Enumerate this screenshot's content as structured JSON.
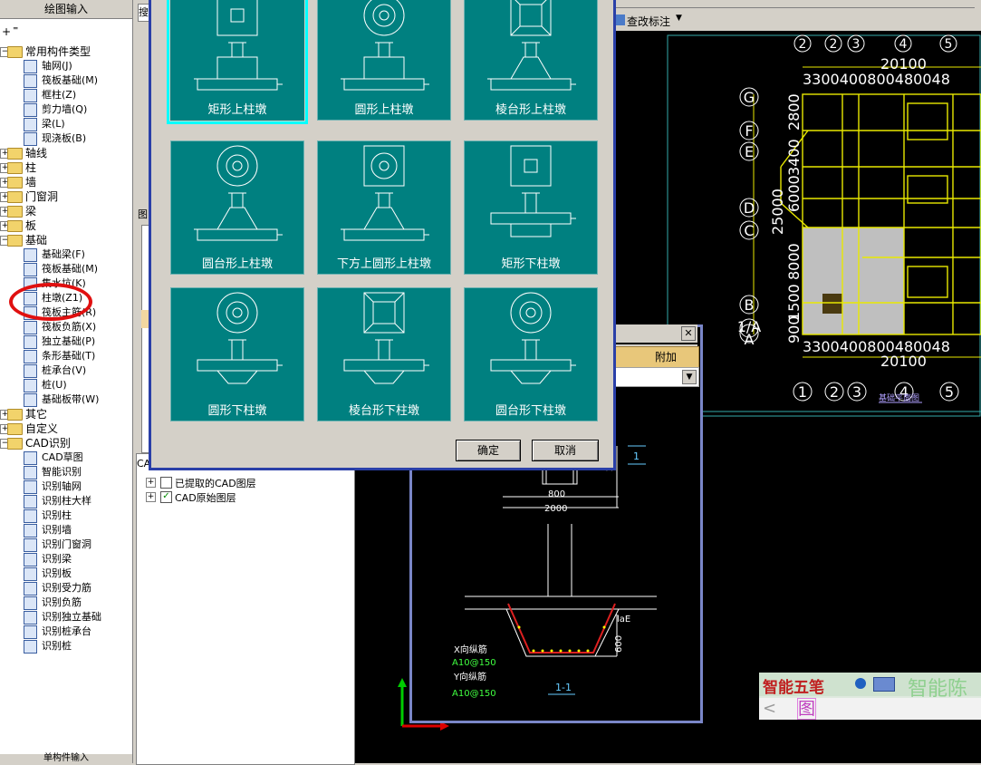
{
  "left_panel": {
    "title": "绘图输入",
    "bottom_label": "单构件输入",
    "tree": [
      {
        "label": "常用构件类型",
        "level": 0,
        "kind": "folder",
        "expanded": true
      },
      {
        "label": "轴网(J)",
        "level": 1,
        "kind": "item",
        "icon": "grid-icon"
      },
      {
        "label": "筏板基础(M)",
        "level": 1,
        "kind": "item",
        "icon": "raft-icon"
      },
      {
        "label": "框柱(Z)",
        "level": 1,
        "kind": "item",
        "icon": "column-icon"
      },
      {
        "label": "剪力墙(Q)",
        "level": 1,
        "kind": "item",
        "icon": "wall-icon"
      },
      {
        "label": "梁(L)",
        "level": 1,
        "kind": "item",
        "icon": "beam-icon"
      },
      {
        "label": "现浇板(B)",
        "level": 1,
        "kind": "item",
        "icon": "slab-icon"
      },
      {
        "label": "轴线",
        "level": 0,
        "kind": "folder",
        "expanded": false
      },
      {
        "label": "柱",
        "level": 0,
        "kind": "folder",
        "expanded": false
      },
      {
        "label": "墙",
        "level": 0,
        "kind": "folder",
        "expanded": false
      },
      {
        "label": "门窗洞",
        "level": 0,
        "kind": "folder",
        "expanded": false
      },
      {
        "label": "梁",
        "level": 0,
        "kind": "folder",
        "expanded": false
      },
      {
        "label": "板",
        "level": 0,
        "kind": "folder",
        "expanded": false
      },
      {
        "label": "基础",
        "level": 0,
        "kind": "folder",
        "expanded": true
      },
      {
        "label": "基础梁(F)",
        "level": 1,
        "kind": "item",
        "icon": "foundation-beam-icon"
      },
      {
        "label": "筏板基础(M)",
        "level": 1,
        "kind": "item",
        "icon": "raft-icon"
      },
      {
        "label": "集水坑(K)",
        "level": 1,
        "kind": "item",
        "icon": "sump-icon"
      },
      {
        "label": "柱墩(Z1)",
        "level": 1,
        "kind": "item",
        "icon": "column-pier-icon"
      },
      {
        "label": "筏板主筋(R)",
        "level": 1,
        "kind": "item",
        "icon": "rebar-icon"
      },
      {
        "label": "筏板负筋(X)",
        "level": 1,
        "kind": "item",
        "icon": "rebar-icon"
      },
      {
        "label": "独立基础(P)",
        "level": 1,
        "kind": "item",
        "icon": "footing-icon"
      },
      {
        "label": "条形基础(T)",
        "level": 1,
        "kind": "item",
        "icon": "strip-footing-icon"
      },
      {
        "label": "桩承台(V)",
        "level": 1,
        "kind": "item",
        "icon": "pile-cap-icon"
      },
      {
        "label": "桩(U)",
        "level": 1,
        "kind": "item",
        "icon": "pile-icon"
      },
      {
        "label": "基础板带(W)",
        "level": 1,
        "kind": "item",
        "icon": "band-icon"
      },
      {
        "label": "其它",
        "level": 0,
        "kind": "folder",
        "expanded": false
      },
      {
        "label": "自定义",
        "level": 0,
        "kind": "folder",
        "expanded": false
      },
      {
        "label": "CAD识别",
        "level": 0,
        "kind": "folder",
        "expanded": true
      },
      {
        "label": "CAD草图",
        "level": 1,
        "kind": "item",
        "icon": "cad-icon"
      },
      {
        "label": "智能识别",
        "level": 1,
        "kind": "item",
        "icon": "smart-icon"
      },
      {
        "label": "识别轴网",
        "level": 1,
        "kind": "item",
        "icon": "recognize-icon"
      },
      {
        "label": "识别柱大样",
        "level": 1,
        "kind": "item",
        "icon": "recognize-icon"
      },
      {
        "label": "识别柱",
        "level": 1,
        "kind": "item",
        "icon": "recognize-icon"
      },
      {
        "label": "识别墙",
        "level": 1,
        "kind": "item",
        "icon": "recognize-icon"
      },
      {
        "label": "识别门窗洞",
        "level": 1,
        "kind": "item",
        "icon": "recognize-icon"
      },
      {
        "label": "识别梁",
        "level": 1,
        "kind": "item",
        "icon": "recognize-icon"
      },
      {
        "label": "识别板",
        "level": 1,
        "kind": "item",
        "icon": "recognize-icon"
      },
      {
        "label": "识别受力筋",
        "level": 1,
        "kind": "item",
        "icon": "recognize-icon"
      },
      {
        "label": "识别负筋",
        "level": 1,
        "kind": "item",
        "icon": "recognize-icon"
      },
      {
        "label": "识别独立基础",
        "level": 1,
        "kind": "item",
        "icon": "recognize-icon"
      },
      {
        "label": "识别桩承台",
        "level": 1,
        "kind": "item",
        "icon": "recognize-icon"
      },
      {
        "label": "识别桩",
        "level": 1,
        "kind": "item",
        "icon": "recognize-icon"
      }
    ]
  },
  "mid_panel": {
    "layer_title": "CAD",
    "layers": [
      {
        "label": "已提取的CAD图层",
        "checked": false
      },
      {
        "label": "CAD原始图层",
        "checked": true
      }
    ]
  },
  "toolbar": {
    "check_label": "查改标注"
  },
  "dialog": {
    "tiles": [
      {
        "label": "矩形上柱墩",
        "type": "rect-up",
        "selected": true
      },
      {
        "label": "圆形上柱墩",
        "type": "circle-up",
        "selected": false
      },
      {
        "label": "棱台形上柱墩",
        "type": "frustum-up",
        "selected": false
      },
      {
        "label": "圆台形上柱墩",
        "type": "cone-up",
        "selected": false
      },
      {
        "label": "下方上圆形上柱墩",
        "type": "square-circle-up",
        "selected": false
      },
      {
        "label": "矩形下柱墩",
        "type": "rect-down",
        "selected": false
      },
      {
        "label": "圆形下柱墩",
        "type": "circle-down",
        "selected": false
      },
      {
        "label": "棱台形下柱墩",
        "type": "frustum-down",
        "selected": false
      },
      {
        "label": "圆台形下柱墩",
        "type": "cone-down",
        "selected": false
      }
    ],
    "ok_label": "确定",
    "cancel_label": "取消"
  },
  "detail_window": {
    "header_label": "附加",
    "dim_2000": "2000",
    "dim_800": "800",
    "dim_2000_bottom": "2000",
    "mark_1": "1",
    "section_label": "1-1",
    "laE": "laE",
    "dim_600": "600",
    "x_rebar_label": "X向纵筋",
    "x_rebar_spec": "A10@150",
    "y_rebar_label": "Y向纵筋",
    "y_rebar_spec": "A10@150"
  },
  "plan": {
    "axis_top": [
      "2",
      "2",
      "3",
      "4",
      "5"
    ],
    "axis_bottom": [
      "1",
      "2",
      "3",
      "4",
      "5"
    ],
    "axis_left": [
      "G",
      "F",
      "E",
      "D",
      "C",
      "B",
      "1/A",
      "A"
    ],
    "dim_top_total": "20100",
    "dim_top_segments": "3300400800480048",
    "dim_bottom_total": "20100",
    "dim_bottom_segments": "3300400800480048",
    "dim_left_total": "25000",
    "dim_left": [
      "2800",
      "3400",
      "6000",
      "8000",
      "1500",
      "900"
    ],
    "title_text": "基础平面图"
  },
  "ime": {
    "brand": "智能五笔",
    "text": "智能陈",
    "candidate": "图"
  }
}
